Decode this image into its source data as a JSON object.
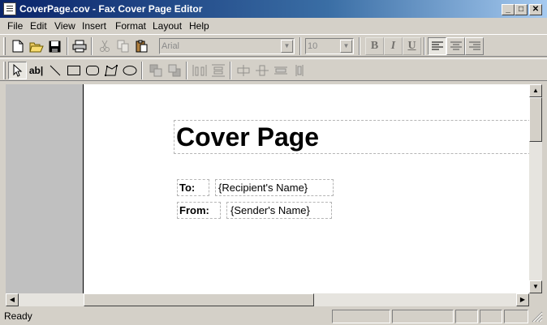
{
  "window": {
    "title": "CoverPage.cov - Fax Cover Page Editor"
  },
  "menu": [
    "File",
    "Edit",
    "View",
    "Insert",
    "Format",
    "Layout",
    "Help"
  ],
  "format_toolbar": {
    "font_name": "Arial",
    "font_size": "10",
    "bold": "B",
    "italic": "I",
    "underline": "U"
  },
  "draw_toolbar": {
    "text_tool_label": "ab|"
  },
  "page": {
    "title": "Cover Page",
    "to_label": "To:",
    "to_value": "{Recipient's Name}",
    "from_label": "From:",
    "from_value": "{Sender's Name}"
  },
  "status": {
    "text": "Ready"
  }
}
